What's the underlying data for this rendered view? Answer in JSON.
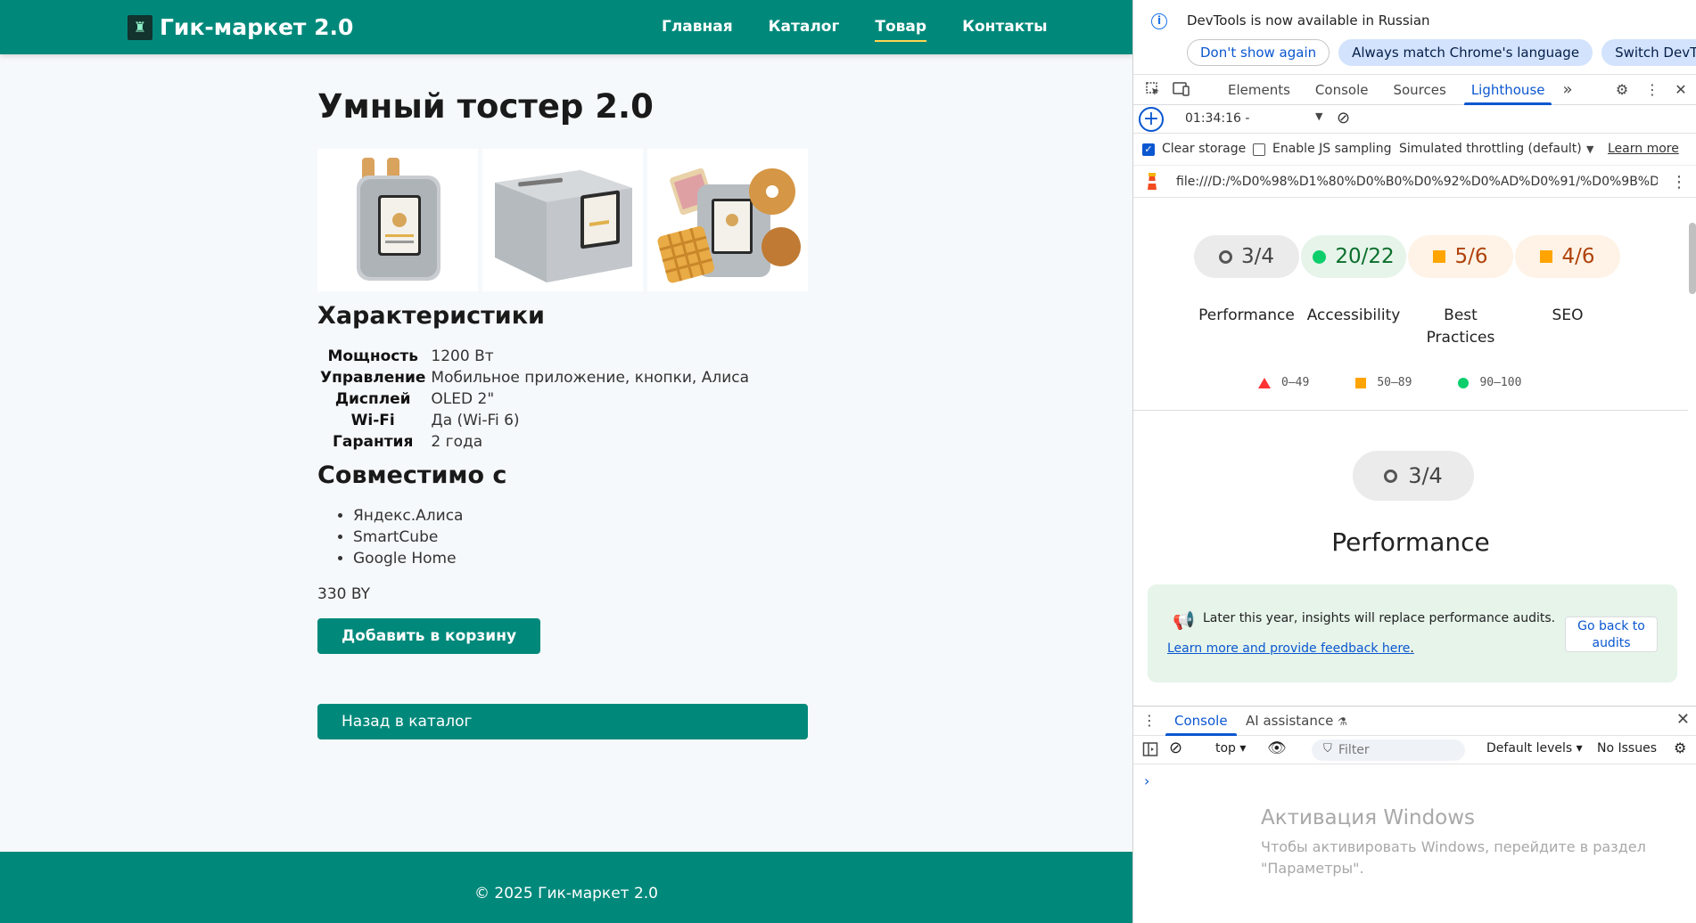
{
  "site": {
    "logo_icon": "♜",
    "brand": "Гик-маркет 2.0",
    "nav": [
      "Главная",
      "Каталог",
      "Товар",
      "Контакты"
    ],
    "active_nav": "Товар",
    "title": "Умный тостер 2.0",
    "gallery": [
      "toaster-front",
      "toaster-angle",
      "toaster-with-pastries"
    ],
    "specs_title": "Характеристики",
    "specs": [
      {
        "key": "Мощность",
        "value": "1200 Вт"
      },
      {
        "key": "Управление",
        "value": "Мобильное приложение, кнопки, Алиса"
      },
      {
        "key": "Дисплей",
        "value": "OLED 2\""
      },
      {
        "key": "Wi-Fi",
        "value": "Да (Wi-Fi 6)"
      },
      {
        "key": "Гарантия",
        "value": "2 года"
      }
    ],
    "compat_title": "Совместимо с",
    "compat": [
      "Яндекс.Алиса",
      "SmartCube",
      "Google Home"
    ],
    "price": "330 BY",
    "add_to_cart": "Добавить в корзину",
    "back_to_catalog": "Назад в каталог",
    "footer": "© 2025 Гик-маркет 2.0",
    "brand_color": "#00897b"
  },
  "devtools": {
    "info": {
      "text": "DevTools is now available in Russian",
      "btn_dont_show": "Don't show again",
      "btn_always_match": "Always match Chrome's language",
      "btn_switch": "Switch DevTools to"
    },
    "tabs": [
      "Elements",
      "Console",
      "Sources",
      "Lighthouse"
    ],
    "active_tab": "Lighthouse",
    "more_tabs": "»",
    "lighthouse": {
      "report_time": "01:34:16 -",
      "clear_storage": "Clear storage",
      "enable_js_sampling": "Enable JS sampling",
      "throttling": "Simulated throttling (default)",
      "learn_more": "Learn more",
      "url": "file:///D:/%D0%98%D1%80%D0%B0%D0%92%D0%AD%D0%91/%D0%9B%D0...",
      "scores": [
        {
          "label": "Performance",
          "value": "3/4",
          "kind": "gray"
        },
        {
          "label": "Accessibility",
          "value": "20/22",
          "kind": "green"
        },
        {
          "label": "Best Practices",
          "value": "5/6",
          "kind": "orange"
        },
        {
          "label": "SEO",
          "value": "4/6",
          "kind": "orange"
        }
      ],
      "legend": [
        "0–49",
        "50–89",
        "90–100"
      ],
      "section_score": "3/4",
      "section_title": "Performance",
      "insight_text": "Later this year, insights will replace performance audits.",
      "insight_link": "Learn more and provide feedback here",
      "insight_link_suffix": ".",
      "go_back_label": "Go back to audits"
    },
    "drawer": {
      "tabs": [
        "Console",
        "AI assistance"
      ],
      "context": "top",
      "filter_placeholder": "Filter",
      "levels": "Default levels",
      "issues": "No Issues",
      "prompt": "›"
    }
  },
  "os_overlay": {
    "title": "Активация Windows",
    "text": "Чтобы активировать Windows, перейдите в раздел \"Параметры\"."
  }
}
